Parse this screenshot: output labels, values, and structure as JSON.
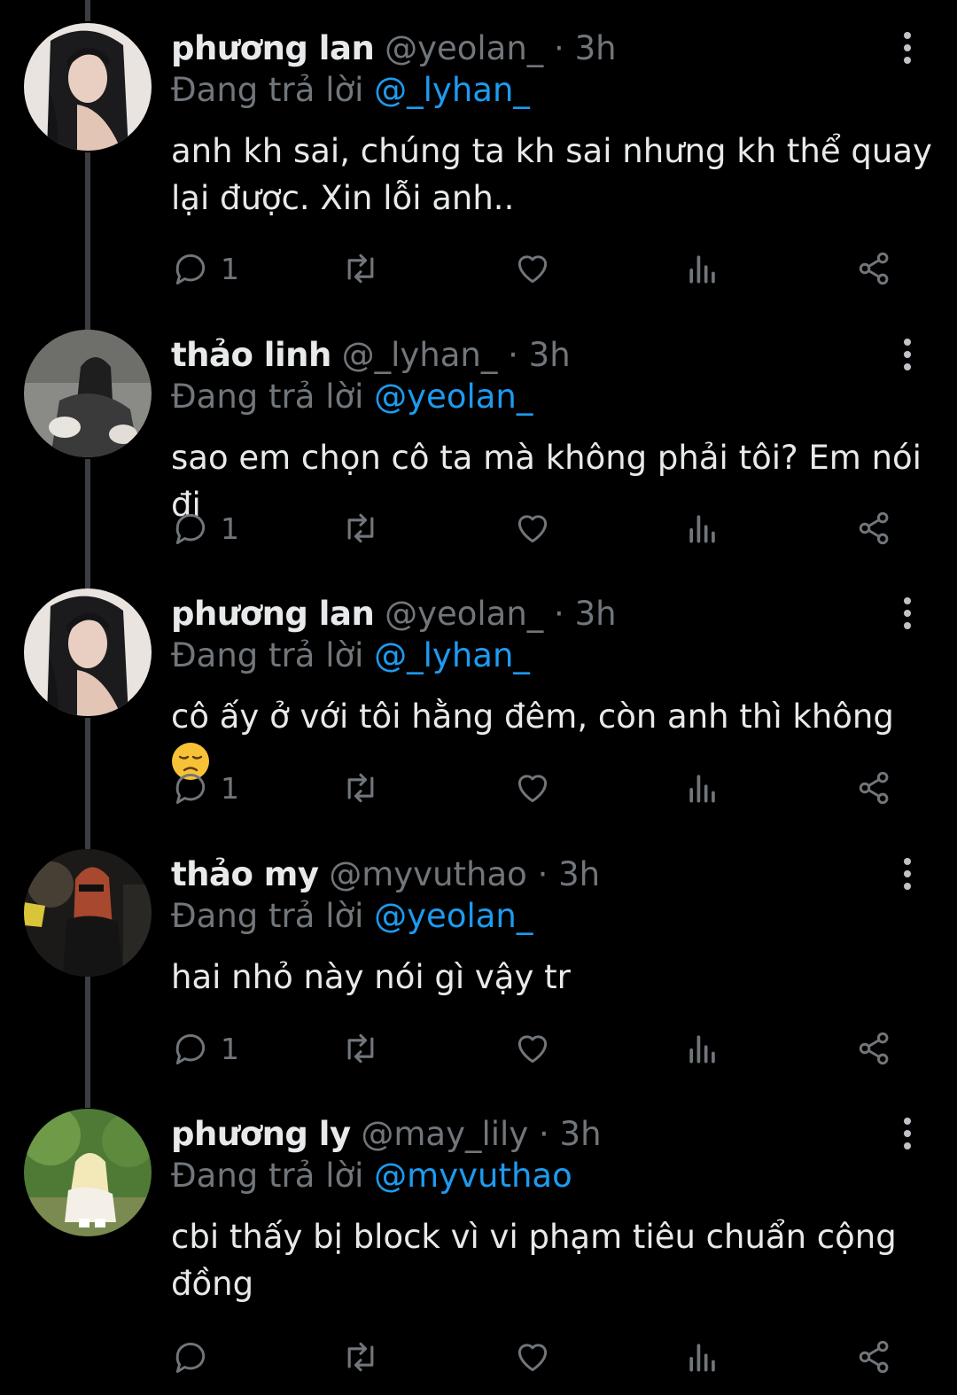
{
  "tweets": [
    {
      "name": "phương lan",
      "handle": "@yeolan_",
      "dot": "·",
      "time": "3h",
      "replying_prefix": "Đang trả lời ",
      "replying_to": "@_lyhan_",
      "text": "anh kh sai, chúng ta kh sai nhưng kh thể quay\nlại được. Xin lỗi anh..",
      "reply_count": "1",
      "avatar_icon": "avatar-photo-phuong-lan"
    },
    {
      "name": "thảo linh",
      "handle": "@_lyhan_",
      "dot": "·",
      "time": "3h",
      "replying_prefix": "Đang trả lời ",
      "replying_to": "@yeolan_",
      "text": "sao em chọn cô ta mà không phải tôi? Em nói đi",
      "reply_count": "1",
      "avatar_icon": "avatar-photo-thao-linh"
    },
    {
      "name": "phương lan",
      "handle": "@yeolan_",
      "dot": "·",
      "time": "3h",
      "replying_prefix": "Đang trả lời ",
      "replying_to": "@_lyhan_",
      "text": "cô ấy ở với tôi hằng đêm, còn anh thì không",
      "text_emoji": "disappointed-face-emoji",
      "reply_count": "1",
      "avatar_icon": "avatar-photo-phuong-lan"
    },
    {
      "name": "thảo my",
      "handle": "@myvuthao",
      "dot": "·",
      "time": "3h",
      "replying_prefix": "Đang trả lời ",
      "replying_to": "@yeolan_",
      "text": "hai nhỏ này nói gì vậy tr",
      "reply_count": "1",
      "avatar_icon": "avatar-photo-thao-my"
    },
    {
      "name": "phương ly",
      "handle": "@may_lily",
      "dot": "·",
      "time": "3h",
      "replying_prefix": "Đang trả lời ",
      "replying_to": "@myvuthao",
      "text": "cbi thấy bị block vì vi phạm tiêu chuẩn cộng\nđồng",
      "reply_count": "",
      "avatar_icon": "avatar-photo-phuong-ly"
    }
  ],
  "icons": {
    "reply": "reply-icon",
    "retweet": "retweet-icon",
    "like": "heart-icon",
    "views": "views-icon",
    "share": "share-icon",
    "more": "more-vertical-icon"
  },
  "colors": {
    "background": "#000000",
    "text": "#e7e9ea",
    "muted": "#71767b",
    "link": "#1d9bf0",
    "thread_line": "#3a3d41"
  }
}
